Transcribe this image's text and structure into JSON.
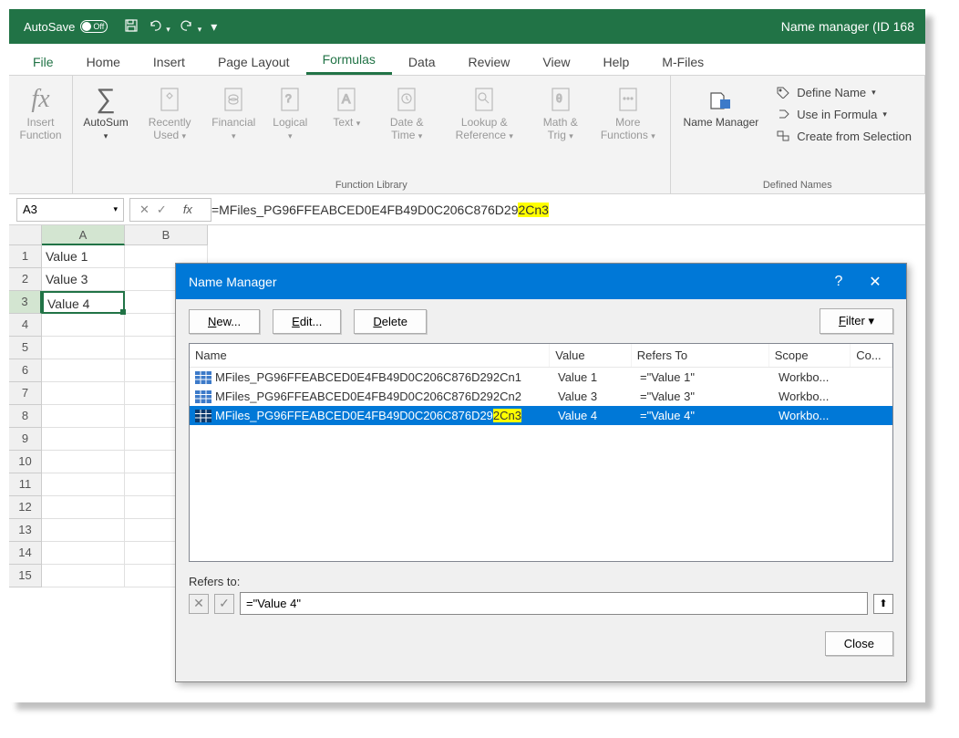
{
  "titlebar": {
    "autosave": "AutoSave",
    "autosave_state": "Off",
    "title": "Name manager (ID 168"
  },
  "tabs": {
    "file": "File",
    "home": "Home",
    "insert": "Insert",
    "page_layout": "Page Layout",
    "formulas": "Formulas",
    "data": "Data",
    "review": "Review",
    "view": "View",
    "help": "Help",
    "mfiles": "M-Files"
  },
  "ribbon": {
    "insert_function": "Insert Function",
    "autosum": "AutoSum",
    "recently": "Recently Used",
    "financial": "Financial",
    "logical": "Logical",
    "text": "Text",
    "datetime": "Date & Time",
    "lookup": "Lookup & Reference",
    "math": "Math & Trig",
    "more": "More Functions",
    "name_manager": "Name Manager",
    "define_name": "Define Name",
    "use_in_formula": "Use in Formula",
    "create_from_selection": "Create from Selection",
    "group_library": "Function Library",
    "group_defined": "Defined Names"
  },
  "formula_bar": {
    "namebox": "A3",
    "formula_prefix": "=MFiles_PG96FFEABCED0E4FB49D0C206C876D29",
    "formula_highlight": "2Cn3"
  },
  "columns": [
    "A",
    "B"
  ],
  "rows": [
    {
      "n": 1,
      "A": "Value 1"
    },
    {
      "n": 2,
      "A": "Value 3"
    },
    {
      "n": 3,
      "A": "Value 4",
      "selected": true
    },
    {
      "n": 4
    },
    {
      "n": 5
    },
    {
      "n": 6
    },
    {
      "n": 7
    },
    {
      "n": 8
    },
    {
      "n": 9
    },
    {
      "n": 10
    },
    {
      "n": 11
    },
    {
      "n": 12
    },
    {
      "n": 13
    },
    {
      "n": 14
    },
    {
      "n": 15
    }
  ],
  "dialog": {
    "title": "Name Manager",
    "new_btn": "New...",
    "edit_btn": "Edit...",
    "delete_btn": "Delete",
    "filter_btn": "Filter",
    "hdr_name": "Name",
    "hdr_value": "Value",
    "hdr_refers": "Refers To",
    "hdr_scope": "Scope",
    "hdr_co": "Co...",
    "refers_to_label": "Refers to:",
    "refers_to_value": "=\"Value 4\"",
    "close_btn": "Close",
    "entries": [
      {
        "name_prefix": "MFiles_PG96FFEABCED0E4FB49D0C206C876D292",
        "name_suffix": "Cn1",
        "value": "Value 1",
        "refers": "=\"Value 1\"",
        "scope": "Workbo...",
        "selected": false,
        "highlight": false
      },
      {
        "name_prefix": "MFiles_PG96FFEABCED0E4FB49D0C206C876D292",
        "name_suffix": "Cn2",
        "value": "Value 3",
        "refers": "=\"Value 3\"",
        "scope": "Workbo...",
        "selected": false,
        "highlight": false
      },
      {
        "name_prefix": "MFiles_PG96FFEABCED0E4FB49D0C206C876D29",
        "name_suffix": "2Cn3",
        "value": "Value 4",
        "refers": "=\"Value 4\"",
        "scope": "Workbo...",
        "selected": true,
        "highlight": true
      }
    ]
  }
}
